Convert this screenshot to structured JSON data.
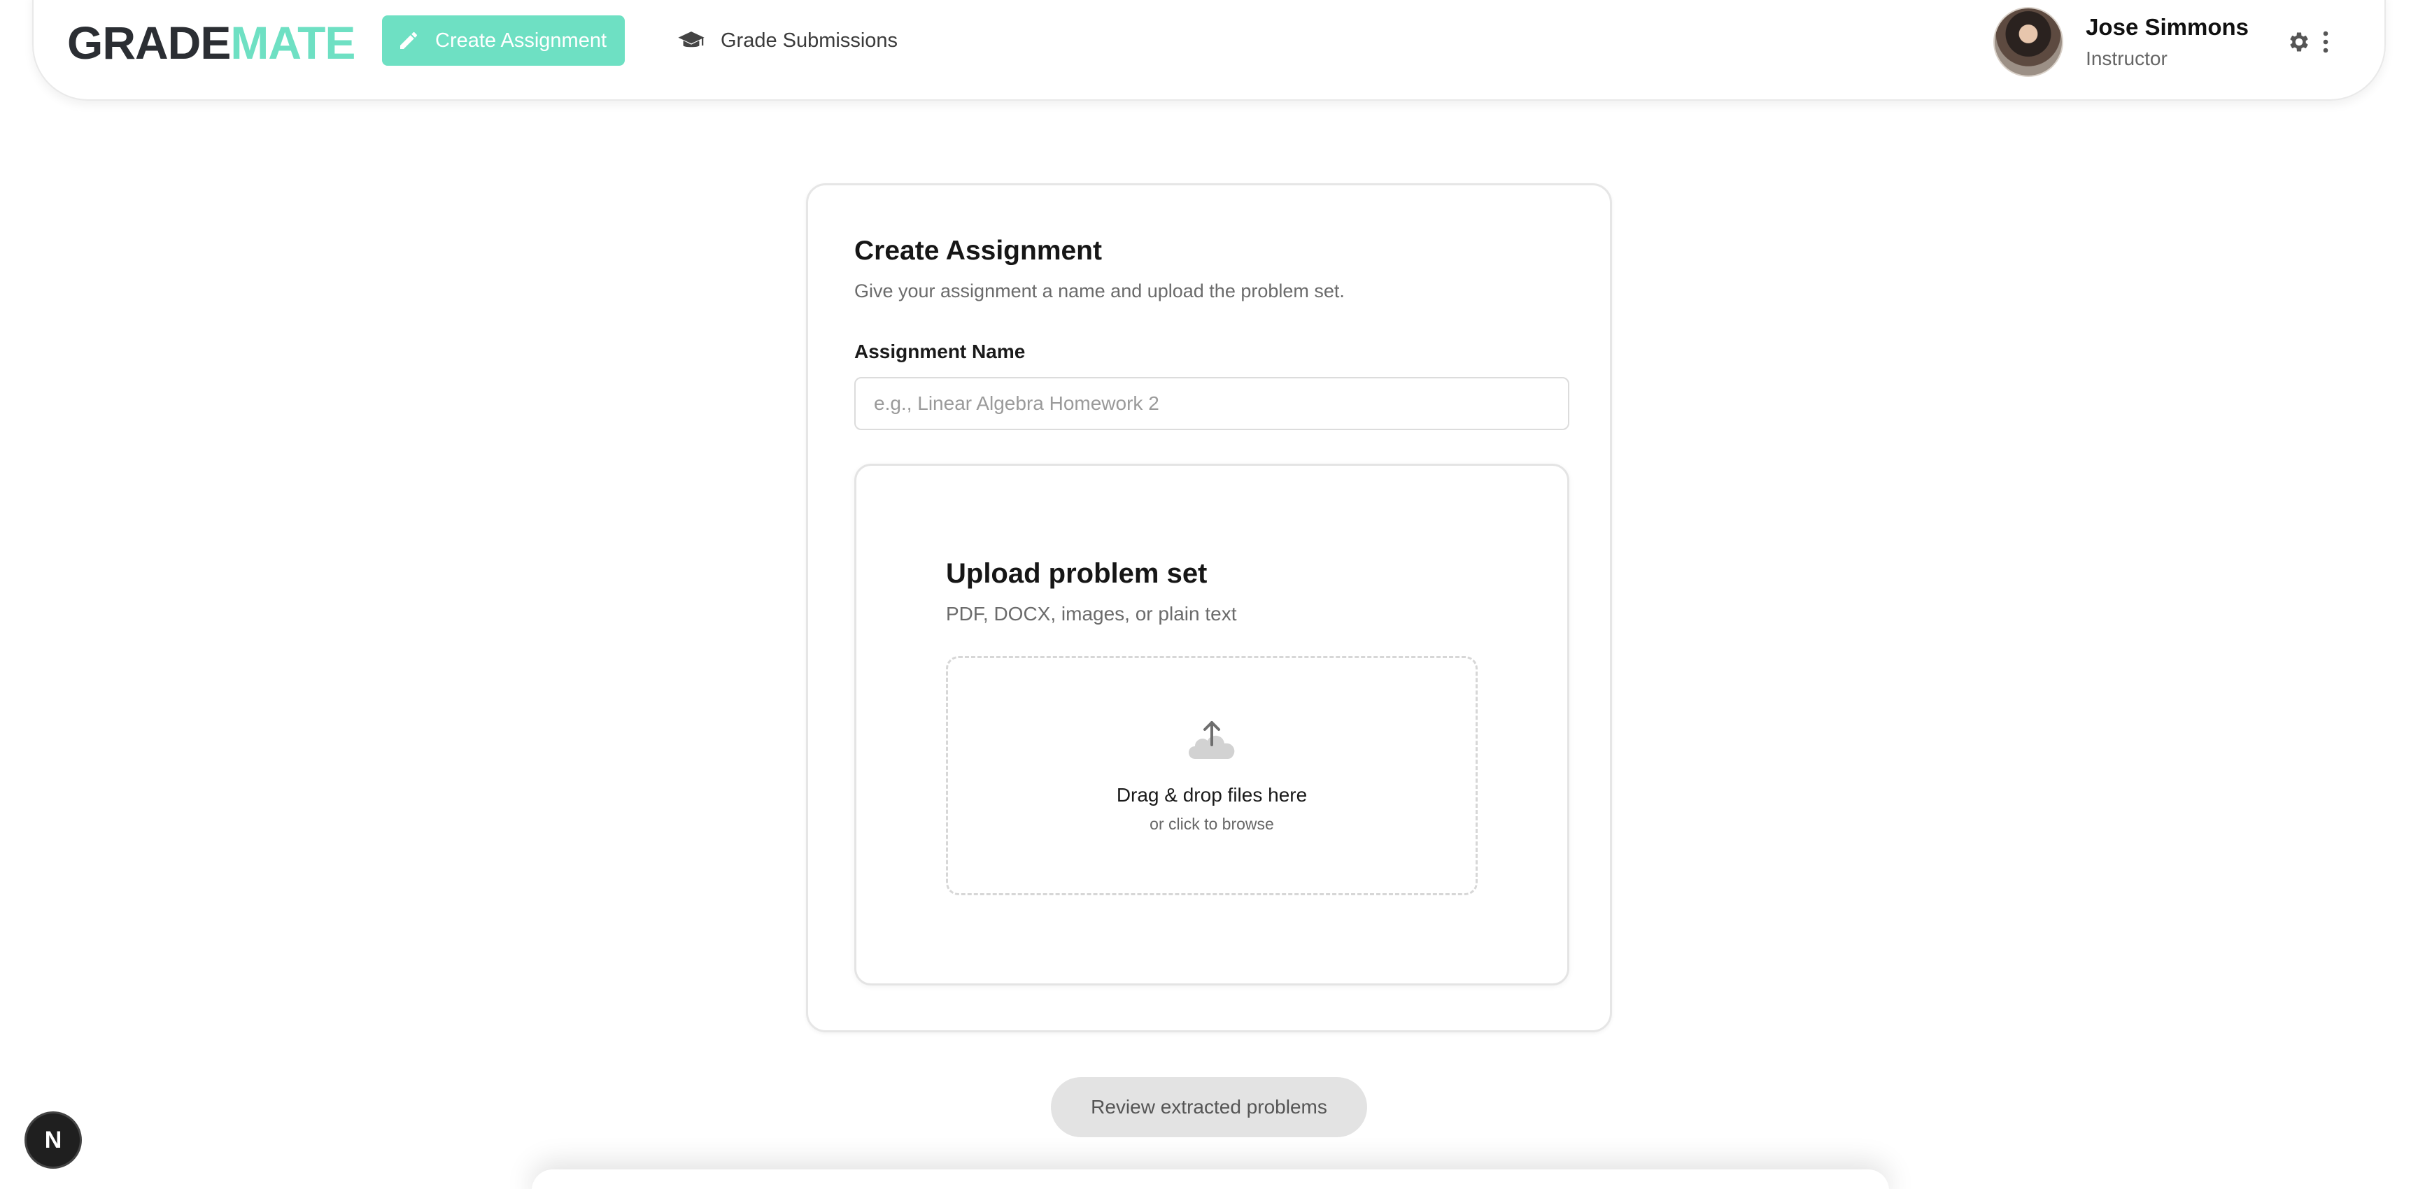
{
  "app": {
    "logo_part1": "GRADE",
    "logo_part2": "MATE",
    "brand_color": "#6ee0c3"
  },
  "nav": {
    "create_label": "Create Assignment",
    "create_icon": "pencil-icon",
    "grade_label": "Grade Submissions",
    "grade_icon": "graduation-cap-icon"
  },
  "user": {
    "name": "Jose Simmons",
    "role": "Instructor",
    "settings_icon": "gear-icon",
    "menu_icon": "kebab-menu-icon"
  },
  "card": {
    "title": "Create Assignment",
    "subtitle": "Give your assignment a name and upload the problem set.",
    "name_label": "Assignment Name",
    "name_value": "",
    "name_placeholder": "e.g., Linear Algebra Homework 2"
  },
  "upload": {
    "title": "Upload problem set",
    "subtitle": "PDF, DOCX, images, or plain text",
    "icon": "cloud-upload-icon",
    "drop_main": "Drag & drop files here",
    "drop_sub": "or click to browse"
  },
  "actions": {
    "review_label": "Review extracted problems"
  },
  "dev_badge": {
    "label": "N"
  }
}
